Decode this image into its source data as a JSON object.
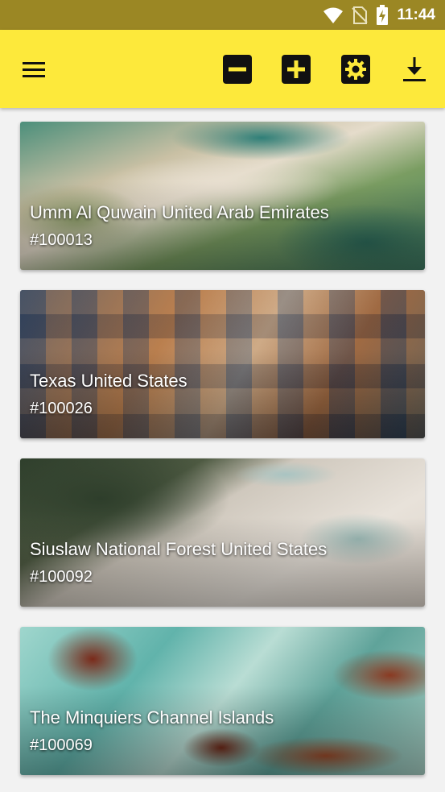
{
  "status_bar": {
    "time": "11:44",
    "icons": [
      "wifi-icon",
      "no-sim-icon",
      "battery-charging-icon"
    ]
  },
  "toolbar": {
    "icons": [
      "menu-icon",
      "zoom-out-icon",
      "zoom-in-icon",
      "settings-icon",
      "download-icon"
    ]
  },
  "cards": [
    {
      "title": "Umm Al Quwain United Arab Emirates",
      "id": "#100013"
    },
    {
      "title": "Texas United States",
      "id": "#100026"
    },
    {
      "title": "Siuslaw National Forest United States",
      "id": "#100092"
    },
    {
      "title": "The Minquiers Channel Islands",
      "id": "#100069"
    }
  ],
  "colors": {
    "status_bar": "#9b8724",
    "app_bar": "#fde93b",
    "background": "#f2f2f2",
    "icon": "#111111"
  }
}
